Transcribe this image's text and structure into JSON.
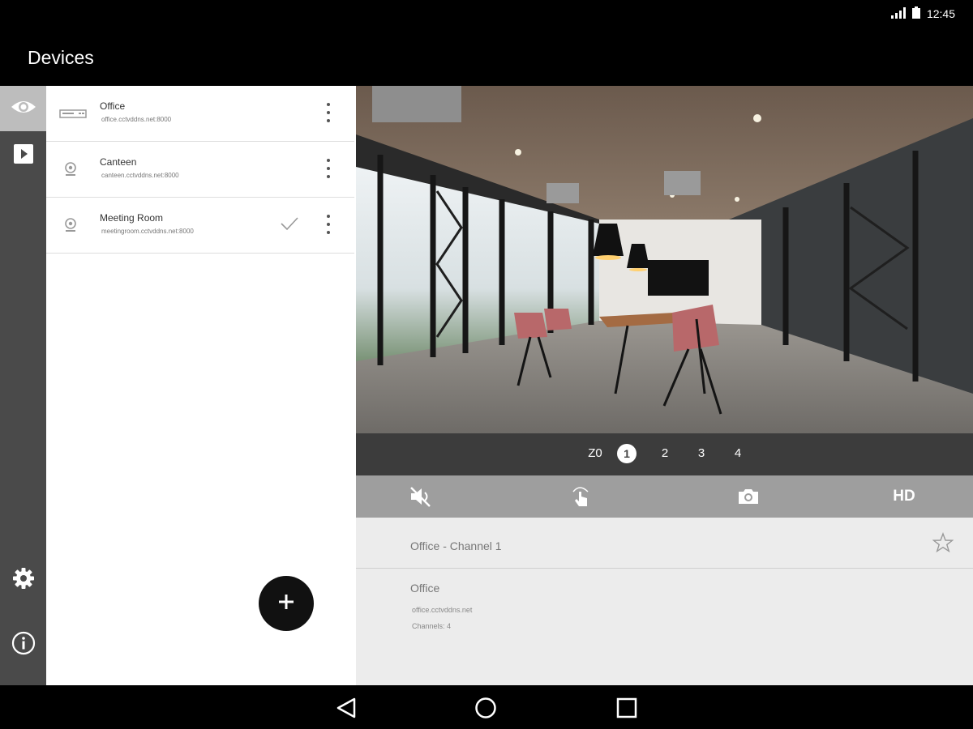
{
  "status_bar": {
    "time": "12:45"
  },
  "app_bar": {
    "title": "Devices"
  },
  "devices": [
    {
      "name": "Office",
      "address": "office.cctvddns.net:8000",
      "type": "recorder",
      "selected": false
    },
    {
      "name": "Canteen",
      "address": "canteen.cctvddns.net:8000",
      "type": "camera",
      "selected": false
    },
    {
      "name": "Meeting Room",
      "address": "meetingroom.cctvddns.net:8000",
      "type": "camera",
      "selected": true
    }
  ],
  "channels": {
    "zoom_label": "Z0",
    "items": [
      "1",
      "2",
      "3",
      "4"
    ],
    "active": "1"
  },
  "controls": {
    "hd_label": "HD"
  },
  "stream": {
    "title": "Office - Channel 1",
    "device_name": "Office",
    "device_host": "office.cctvddns.net",
    "channels_text": "Channels: 4"
  },
  "colors": {
    "rail": "#4a4a4a",
    "rail_active": "#bdbdbd",
    "channel_bar": "#3c3c3c",
    "control_bar": "#9e9e9e",
    "info_bg": "#ececec"
  }
}
